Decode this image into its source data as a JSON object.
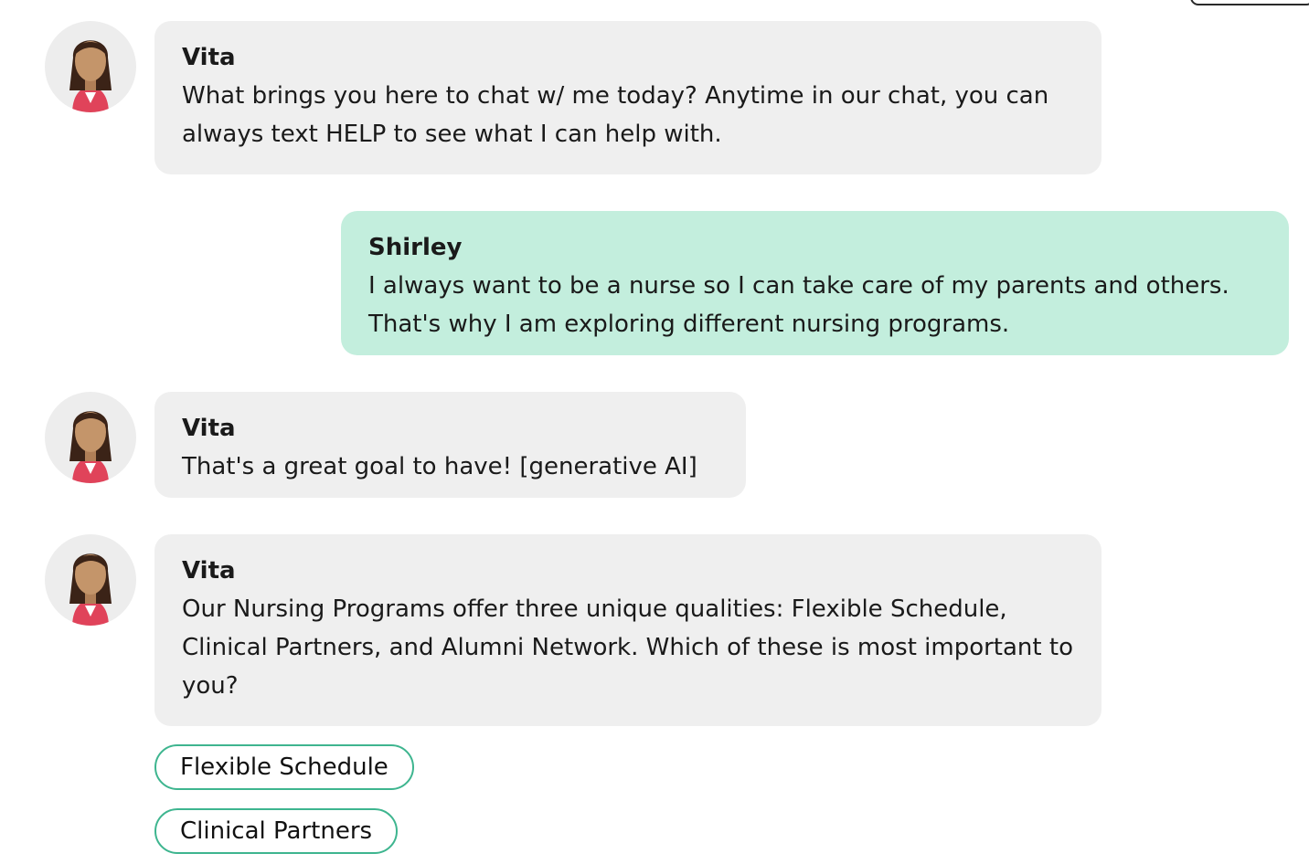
{
  "messages": [
    {
      "sender": "Vita",
      "text": "What brings you here to chat w/ me today? Anytime in our chat, you can always text HELP to see what I can help with."
    },
    {
      "sender": "Shirley",
      "text": "I always want to be a nurse so I can take care of my parents and others. That's why I am exploring different nursing programs."
    },
    {
      "sender": "Vita",
      "text": "That's a great goal to have! [generative AI]"
    },
    {
      "sender": "Vita",
      "text": "Our Nursing Programs offer three unique qualities: Flexible Schedule, Clinical Partners, and Alumni Network. Which of these is most important to you?"
    }
  ],
  "quick_replies": [
    "Flexible Schedule",
    "Clinical Partners"
  ],
  "colors": {
    "bot_bubble": "#efefef",
    "user_bubble": "#c3eedd",
    "chip_border": "#3eb58f",
    "avatar_jacket": "#e0435a",
    "avatar_skin": "#c4956a",
    "avatar_hair": "#3b2317"
  },
  "icons": {
    "bot_avatar": "woman-avatar-icon"
  }
}
